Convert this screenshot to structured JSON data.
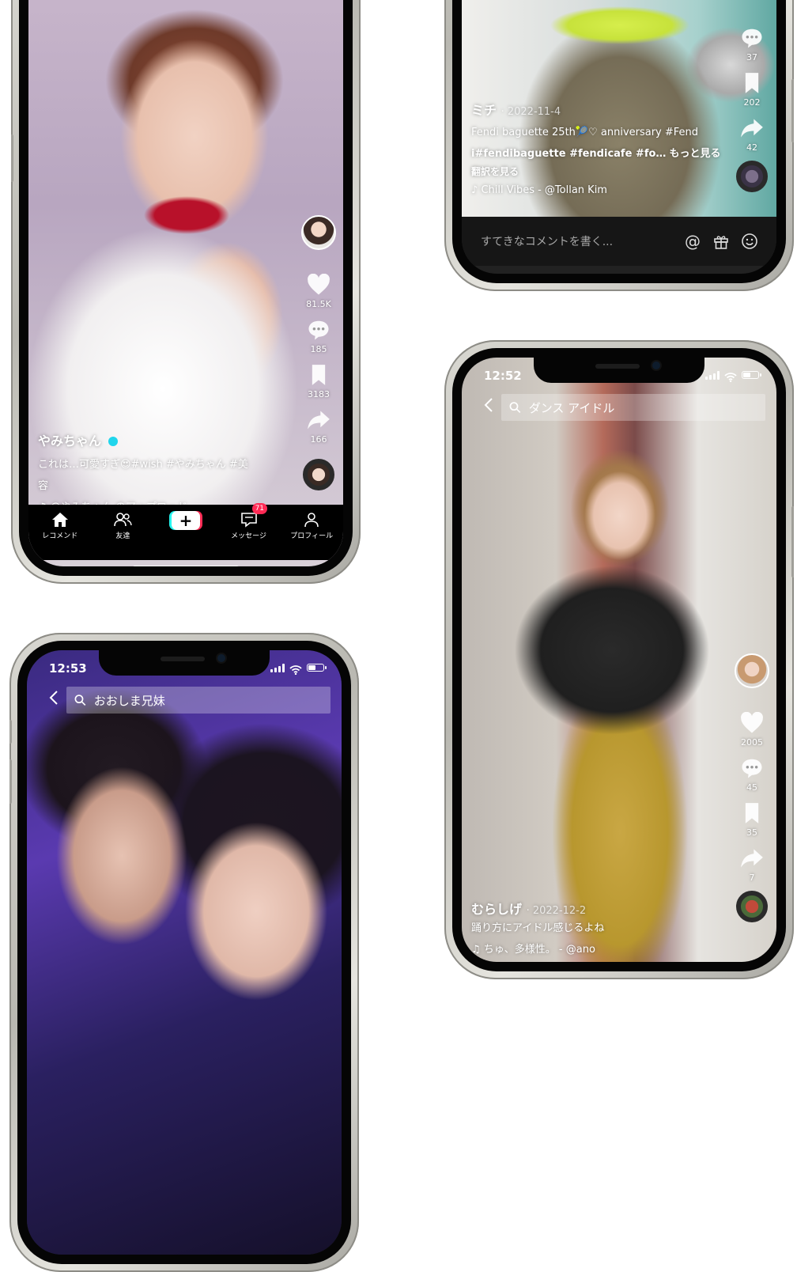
{
  "phone_top_left": {
    "user": "やみちゃん",
    "verified": true,
    "desc_line1": "これは…可愛すぎ😍#wish #やみちゃん #美",
    "desc_line2": "容",
    "music": "@やみちゃん のアップロード",
    "actions": [
      {
        "icon": "heart-icon",
        "count": "81.5K"
      },
      {
        "icon": "comment-icon",
        "count": "185"
      },
      {
        "icon": "bookmark-icon",
        "count": "3183"
      },
      {
        "icon": "share-icon",
        "count": "166"
      }
    ],
    "tabs": [
      {
        "icon": "home-icon",
        "label": "レコメンド"
      },
      {
        "icon": "friends-icon",
        "label": "友達"
      },
      {
        "icon": "create-icon",
        "label": ""
      },
      {
        "icon": "inbox-icon",
        "label": "メッセージ",
        "badge": "71"
      },
      {
        "icon": "profile-icon",
        "label": "プロフィール"
      }
    ]
  },
  "phone_top_right": {
    "user": "ミチ",
    "date": "· 2022-11-4",
    "desc_line1": "Fendi baguette 25th🎾♡ anniversary  #Fend",
    "desc_line2": "i#fendibaguette #fendicafe #fo…",
    "more": "もっと見る",
    "translate": "翻訳を見る",
    "music": "Chill Vibes - @Tollan Kim",
    "actions": [
      {
        "icon": "comment-icon",
        "count": "37"
      },
      {
        "icon": "bookmark-icon",
        "count": "202"
      },
      {
        "icon": "share-icon",
        "count": "42"
      }
    ],
    "comment_placeholder": "すてきなコメントを書く..."
  },
  "phone_bottom_left": {
    "time": "12:53",
    "search": "おおしま兄妹"
  },
  "phone_bottom_right": {
    "time": "12:52",
    "search": "ダンス アイドル",
    "user": "むらしげ",
    "date": "· 2022-12-2",
    "desc_line1": "踊り方にアイドル感じるよね",
    "music": "ちゅ、多様性。 - @ano",
    "actions": [
      {
        "icon": "heart-icon",
        "count": "2005"
      },
      {
        "icon": "comment-icon",
        "count": "45"
      },
      {
        "icon": "bookmark-icon",
        "count": "35"
      },
      {
        "icon": "share-icon",
        "count": "7"
      }
    ]
  }
}
